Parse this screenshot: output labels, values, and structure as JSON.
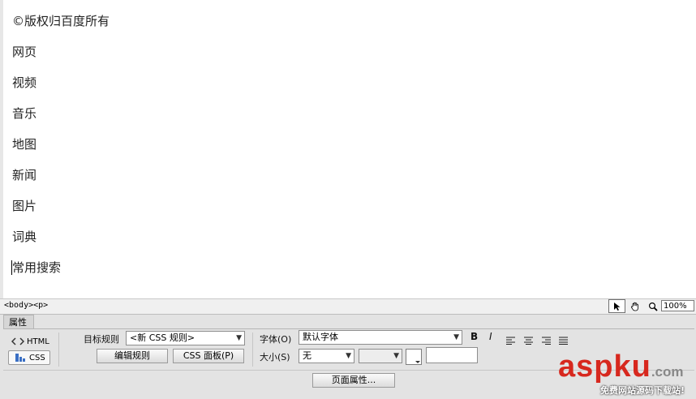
{
  "document": {
    "lines": [
      "©版权归百度所有",
      "网页",
      "视频",
      "音乐",
      "地图",
      "新闻",
      "图片",
      "词典",
      "常用搜索"
    ]
  },
  "statusbar": {
    "tag_selector": "<body><p>",
    "zoom": "100%"
  },
  "properties": {
    "tab_label": "属性",
    "html_button": "HTML",
    "css_button": "CSS",
    "target_rule_label": "目标规则",
    "target_rule_value": "<新 CSS 规则>",
    "edit_rule_button": "编辑规则",
    "css_panel_button": "CSS 面板(P)",
    "font_label": "字体(O)",
    "font_value": "默认字体",
    "size_label": "大小(S)",
    "size_value": "无",
    "unit_value": "",
    "color_value": "",
    "page_props_button": "页面属性...",
    "bold_label": "B",
    "italic_label": "I"
  },
  "watermark": {
    "brand": "aspku",
    "tld": ".com",
    "tagline": "免费网站源码下载站!"
  }
}
